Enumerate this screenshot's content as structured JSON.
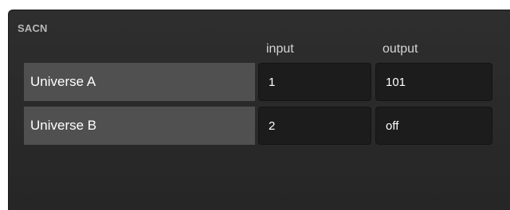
{
  "section": {
    "title": "SACN"
  },
  "columns": {
    "input": "input",
    "output": "output"
  },
  "rows": [
    {
      "label": "Universe A",
      "input": "1",
      "output": "101"
    },
    {
      "label": "Universe B",
      "input": "2",
      "output": "off"
    }
  ]
}
